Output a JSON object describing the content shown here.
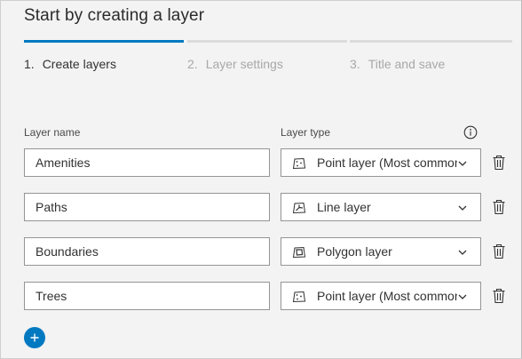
{
  "title": "Start by creating a layer",
  "steps": [
    {
      "num": "1.",
      "label": "Create layers",
      "active": true
    },
    {
      "num": "2.",
      "label": "Layer settings",
      "active": false
    },
    {
      "num": "3.",
      "label": "Title and save",
      "active": false
    }
  ],
  "columns": {
    "name": "Layer name",
    "type": "Layer type"
  },
  "layers": [
    {
      "name": "Amenities",
      "type": "Point layer (Most commonly used)",
      "type_icon": "point-layer-icon"
    },
    {
      "name": "Paths",
      "type": "Line layer",
      "type_icon": "line-layer-icon"
    },
    {
      "name": "Boundaries",
      "type": "Polygon layer",
      "type_icon": "polygon-layer-icon"
    },
    {
      "name": "Trees",
      "type": "Point layer (Most commonly used)",
      "type_icon": "point-layer-icon"
    }
  ],
  "colors": {
    "accent": "#0079c1",
    "border": "#959595",
    "background": "#f3f3f3"
  }
}
